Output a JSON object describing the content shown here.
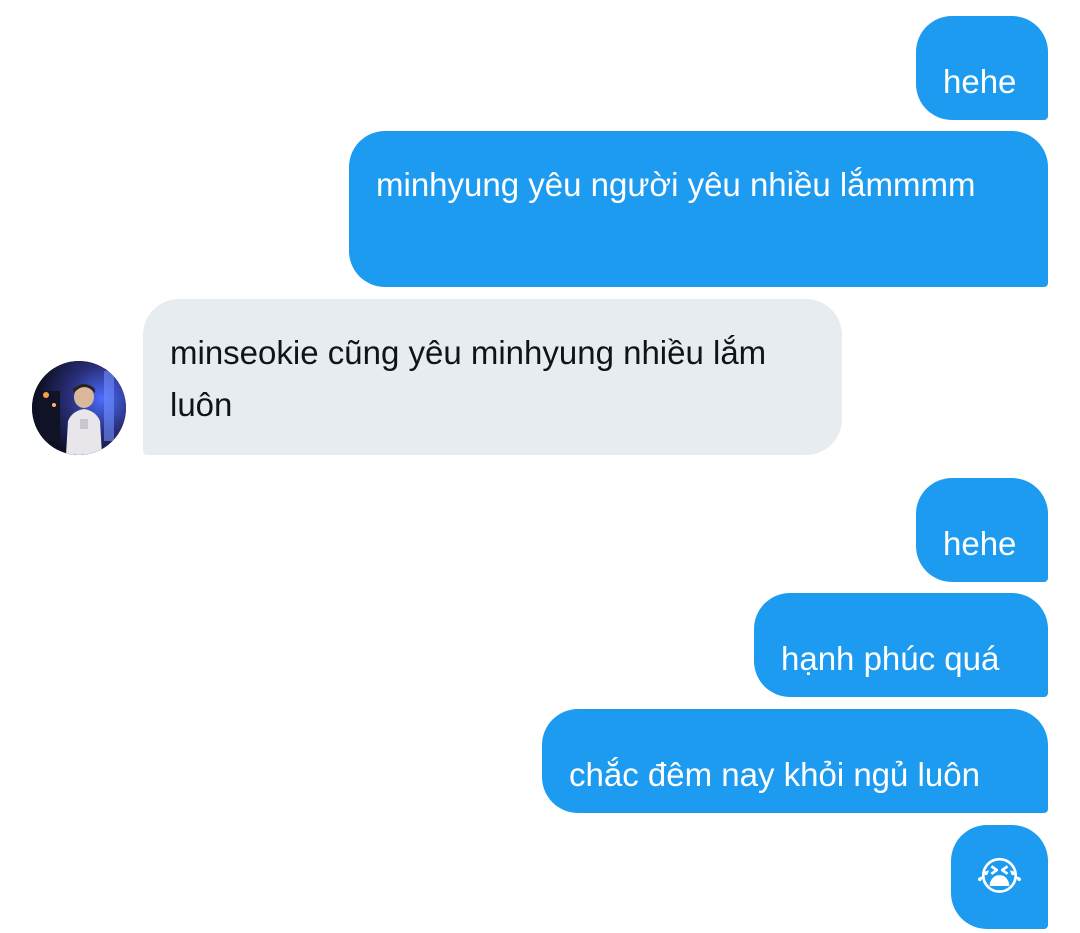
{
  "conversation": {
    "messages": [
      {
        "sender": "me",
        "text": "hehe"
      },
      {
        "sender": "me",
        "text": "minhyung yêu người yêu nhiều lắmmmm"
      },
      {
        "sender": "other",
        "text": "minseokie cũng yêu minhyung nhiều lắm luôn"
      },
      {
        "sender": "me",
        "text": "hehe"
      },
      {
        "sender": "me",
        "text": "hạnh phúc quá"
      },
      {
        "sender": "me",
        "text": "chắc đêm nay khỏi ngủ luôn"
      },
      {
        "sender": "me",
        "text": "😭"
      }
    ]
  },
  "colors": {
    "sent_bubble": "#1d9bf0",
    "received_bubble": "#e7ecf0",
    "sent_text": "#ffffff",
    "received_text": "#0f1419"
  },
  "icons": {
    "avatar": "contact-avatar-photo",
    "emoji": "loudly-crying-face"
  }
}
